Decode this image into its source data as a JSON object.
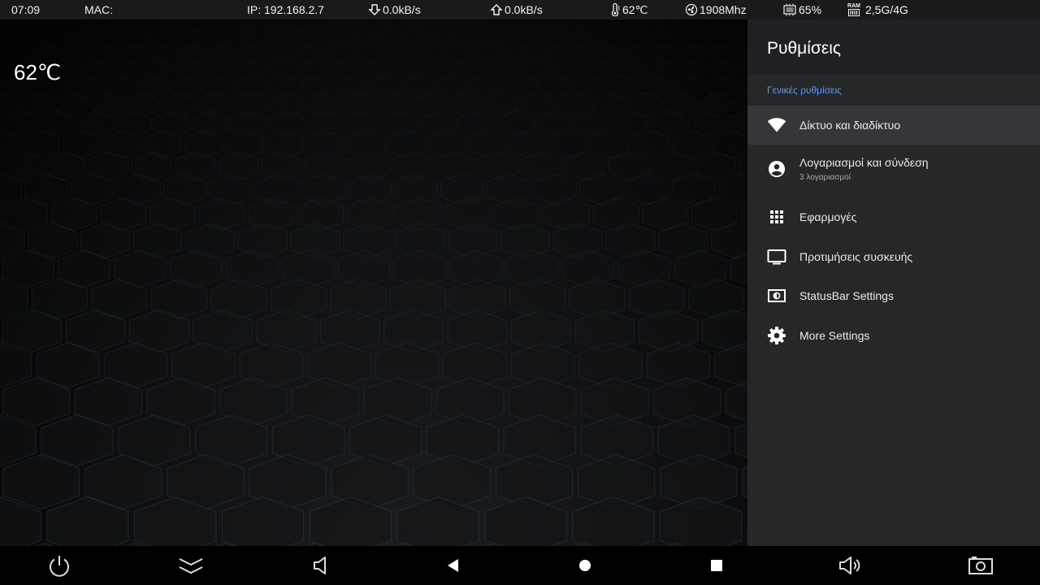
{
  "status": {
    "time": "07:09",
    "mac": "MAC:",
    "ip": "IP: 192.168.2.7",
    "download": "0.0kB/s",
    "upload": "0.0kB/s",
    "temp": "62℃",
    "cpu": "1908Mhz",
    "load": "65%",
    "ram_tag": "RAM",
    "ram": "2,5G/4G"
  },
  "widget": {
    "temp": "62℃"
  },
  "panel": {
    "title": "Ρυθμίσεις",
    "section": "Γενικές ρυθμίσεις",
    "items": [
      {
        "label": "Δίκτυο και διαδίκτυο",
        "icon": "wifi-icon",
        "selected": true
      },
      {
        "label": "Λογαριασμοί και σύνδεση",
        "sub": "3 λογαριασμοί",
        "icon": "account-icon"
      },
      {
        "label": "Εφαρμογές",
        "icon": "apps-grid-icon"
      },
      {
        "label": "Προτιμήσεις συσκευής",
        "icon": "tv-icon"
      },
      {
        "label": "StatusBar Settings",
        "icon": "statusbar-icon"
      },
      {
        "label": "More Settings",
        "icon": "gear-icon"
      }
    ]
  },
  "navbar": [
    "power-icon",
    "collapse-icon",
    "volume-down-icon",
    "back-icon",
    "home-icon",
    "recents-icon",
    "volume-up-icon",
    "screenshot-icon"
  ],
  "colors": {
    "accent": "#5e97f6",
    "panel": "#202124",
    "panel_body": "#262729",
    "selected": "#34363a",
    "statusbar": "#1a1a1a"
  }
}
